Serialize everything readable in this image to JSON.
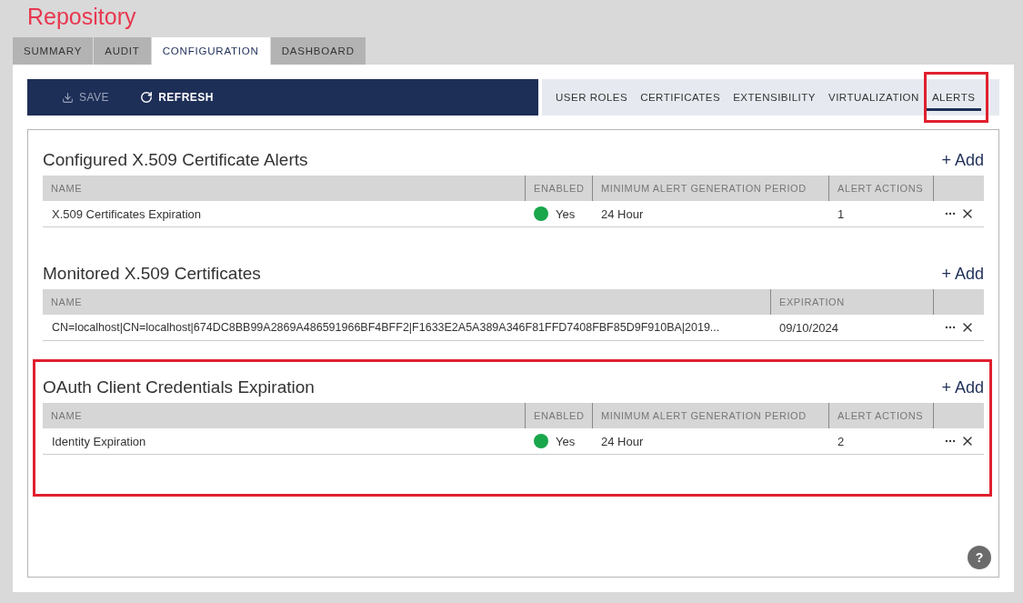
{
  "page_title": "Repository",
  "tabs": [
    {
      "label": "SUMMARY",
      "selected": false
    },
    {
      "label": "AUDIT",
      "selected": false
    },
    {
      "label": "CONFIGURATION",
      "selected": true
    },
    {
      "label": "DASHBOARD",
      "selected": false
    }
  ],
  "toolbar": [
    {
      "label": "SAVE",
      "kind": "save",
      "disabled": true
    },
    {
      "label": "REFRESH",
      "kind": "refresh",
      "disabled": false
    }
  ],
  "subnav": [
    {
      "label": "USER ROLES",
      "selected": false,
      "highlighted": false
    },
    {
      "label": "CERTIFICATES",
      "selected": false,
      "highlighted": false
    },
    {
      "label": "EXTENSIBILITY",
      "selected": false,
      "highlighted": false
    },
    {
      "label": "VIRTUALIZATION",
      "selected": false,
      "highlighted": false
    },
    {
      "label": "ALERTS",
      "selected": true,
      "highlighted": true
    }
  ],
  "sections": [
    {
      "kind": "alerts",
      "title": "Configured X.509 Certificate Alerts",
      "add": "+ Add",
      "columns": [
        "NAME",
        "ENABLED",
        "MINIMUM ALERT GENERATION PERIOD",
        "ALERT ACTIONS"
      ],
      "rows": [
        {
          "name": "X.509 Certificates Expiration",
          "enabled": "Yes",
          "color": "#1aa64b",
          "period": "24 Hour",
          "actions": "1"
        }
      ]
    },
    {
      "kind": "certificates",
      "title": "Monitored X.509 Certificates",
      "add": "+ Add",
      "columns": [
        "NAME",
        "EXPIRATION"
      ],
      "rows": [
        {
          "name": "CN=localhost|CN=localhost|674DC8BB99A2869A486591966BF4BFF2|F1633E2A5A389A346F81FFD7408FBF85D9F910BA|2019...",
          "expiration": "09/10/2024"
        }
      ]
    },
    {
      "kind": "alerts",
      "title": "OAuth Client Credentials Expiration",
      "add": "+ Add",
      "highlighted": true,
      "columns": [
        "NAME",
        "ENABLED",
        "MINIMUM ALERT GENERATION PERIOD",
        "ALERT ACTIONS"
      ],
      "rows": [
        {
          "name": "Identity Expiration",
          "enabled": "Yes",
          "color": "#1aa64b",
          "period": "24 Hour",
          "actions": "2"
        }
      ]
    }
  ],
  "help": "?"
}
